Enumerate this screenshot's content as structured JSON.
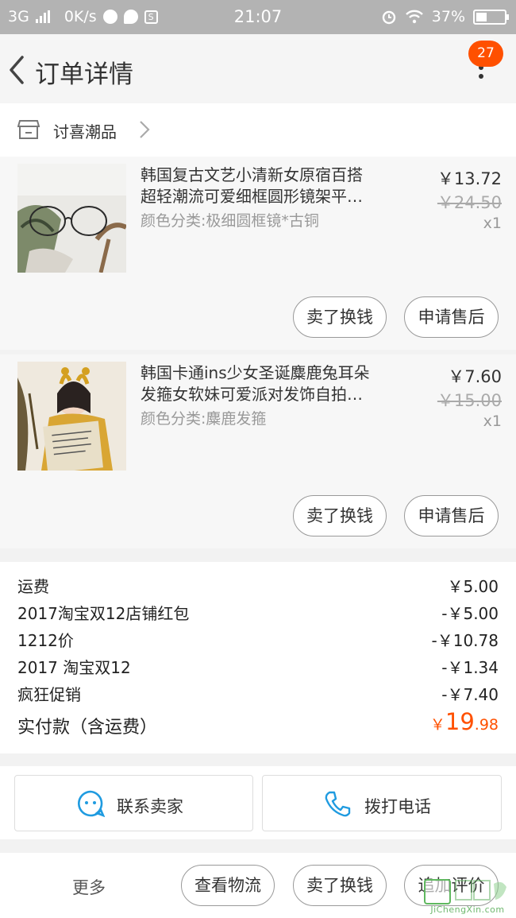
{
  "status_bar": {
    "network": "3G",
    "speed": "0K/s",
    "time": "21:07",
    "battery": "37%"
  },
  "header": {
    "title": "订单详情",
    "badge": "27"
  },
  "shop": {
    "name": "讨喜潮品"
  },
  "items": [
    {
      "name_line1": "韩国复古文艺小清新女原宿百搭",
      "name_line2": "超轻潮流可爱细框圆形镜架平…",
      "sku": "颜色分类:极细圆框镜*古铜",
      "price": "￥13.72",
      "original_price": "￥24.50",
      "quantity": "x1",
      "sell_label": "卖了换钱",
      "after_sale_label": "申请售后"
    },
    {
      "name_line1": "韩国卡通ins少女圣诞麋鹿兔耳朵",
      "name_line2": "发箍女软妹可爱派对发饰自拍…",
      "sku": "颜色分类:麋鹿发箍",
      "price": "￥7.60",
      "original_price": "￥15.00",
      "quantity": "x1",
      "sell_label": "卖了换钱",
      "after_sale_label": "申请售后"
    }
  ],
  "summary": {
    "rows": [
      {
        "label": "运费",
        "value": "￥5.00"
      },
      {
        "label": "2017淘宝双12店铺红包",
        "value": "-￥5.00"
      },
      {
        "label": "1212价",
        "value": "-￥10.78"
      },
      {
        "label": "2017 淘宝双12",
        "value": "-￥1.34"
      },
      {
        "label": "疯狂促销",
        "value": "-￥7.40"
      }
    ],
    "total_label": "实付款（含运费）",
    "total_currency": "￥",
    "total_int": "19",
    "total_dec": ".98"
  },
  "contact": {
    "seller_label": "联系卖家",
    "phone_label": "拨打电话"
  },
  "bottom": {
    "more_label": "更多",
    "logistics_label": "查看物流",
    "sell_label": "卖了换钱",
    "review_label": "追加评价"
  },
  "watermark": {
    "text": "JiChengXin.com"
  },
  "colors": {
    "accent": "#ff5000",
    "contact_icon": "#1f9be0",
    "status_bar": "#b3b3b3"
  }
}
